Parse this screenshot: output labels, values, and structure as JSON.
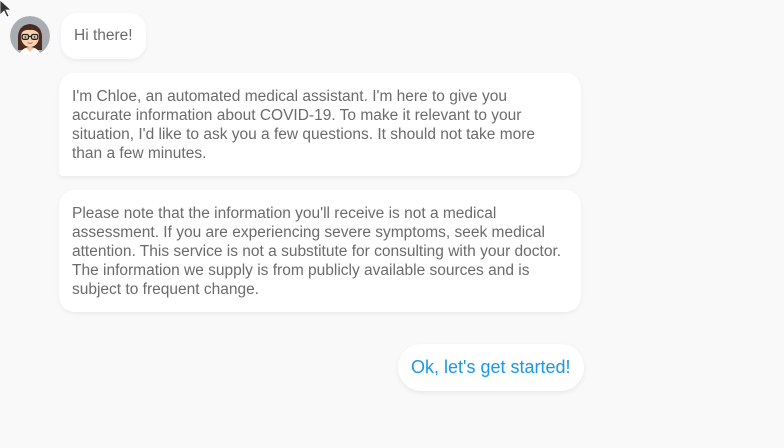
{
  "chat": {
    "assistant_avatar_icon": "woman-with-glasses-avatar-icon",
    "messages": [
      {
        "sender": "assistant",
        "text": "Hi there!"
      },
      {
        "sender": "assistant",
        "text": "I'm Chloe, an automated medical assistant. I'm here to give you accurate information about COVID-19. To make it relevant to your situation, I'd like to ask you a few questions. It should not take more than a few minutes."
      },
      {
        "sender": "assistant",
        "text": "Please note that the information you'll receive is not a medical assessment. If you are experiencing severe symptoms, seek medical attention. This service is not a substitute for consulting with your doctor. The information we supply is from publicly available sources and is subject to frequent change."
      }
    ],
    "quick_reply": {
      "label": "Ok, let's get started!"
    }
  },
  "colors": {
    "background": "#f9f9f9",
    "bubble": "#ffffff",
    "message_text": "#6b6b6b",
    "accent": "#1a97e6"
  }
}
